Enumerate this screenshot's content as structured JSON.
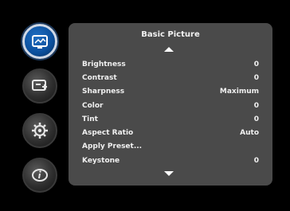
{
  "sidebar": {
    "items": [
      {
        "icon": "picture-icon",
        "active": true
      },
      {
        "icon": "setup-icon",
        "active": false
      },
      {
        "icon": "gear-icon",
        "active": false
      },
      {
        "icon": "info-icon",
        "active": false
      }
    ]
  },
  "menu": {
    "title": "Basic Picture",
    "items": [
      {
        "label": "Brightness",
        "value": "0"
      },
      {
        "label": "Contrast",
        "value": "0"
      },
      {
        "label": "Sharpness",
        "value": "Maximum"
      },
      {
        "label": "Color",
        "value": "0"
      },
      {
        "label": "Tint",
        "value": "0"
      },
      {
        "label": "Aspect Ratio",
        "value": "Auto"
      },
      {
        "label": "Apply Preset...",
        "value": ""
      },
      {
        "label": "Keystone",
        "value": "0"
      }
    ]
  },
  "colors": {
    "panel": "#4a4a4a",
    "active_button": "#0b4f9c"
  }
}
